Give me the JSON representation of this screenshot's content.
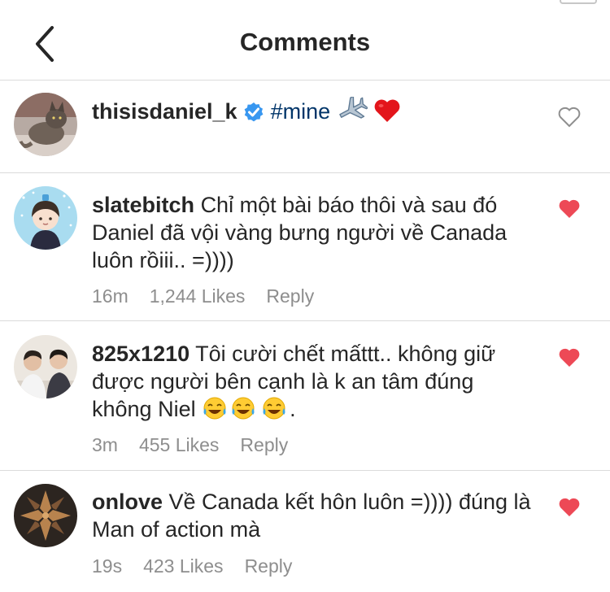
{
  "header": {
    "title": "Comments"
  },
  "caption": {
    "username": "thisisdaniel_k",
    "hashtag": "#mine",
    "verified": true
  },
  "comments": [
    {
      "username": "slatebitch",
      "text": "Chỉ một bài báo thôi và sau đó Daniel đã vội vàng bưng người về Canada luôn rồiii.. =))))",
      "time": "16m",
      "likes": "1,244 Likes",
      "reply": "Reply",
      "liked": true
    },
    {
      "username": "825x1210",
      "text": "Tôi cười chết mấttt.. không giữ được người bên cạnh là k an tâm đúng không Niel",
      "text_end": ".",
      "time": "3m",
      "likes": "455 Likes",
      "reply": "Reply",
      "liked": true
    },
    {
      "username": "onlove",
      "text": "Về Canada kết hôn luôn =)))) đúng là Man of action mà",
      "time": "19s",
      "likes": "423 Likes",
      "reply": "Reply",
      "liked": true
    }
  ],
  "icons": {
    "back": "chevron-left-icon",
    "verified": "verified-badge-icon",
    "airplane": "airplane-icon",
    "red_heart": "red-heart-icon",
    "laugh": "tears-of-joy-icon",
    "like_empty": "heart-outline-icon",
    "like_filled": "heart-filled-icon"
  },
  "colors": {
    "heart_red": "#ed4956",
    "hashtag": "#003569",
    "meta_gray": "#8e8e8e",
    "divider": "#dbdbdb",
    "verified_blue": "#3897f0"
  }
}
